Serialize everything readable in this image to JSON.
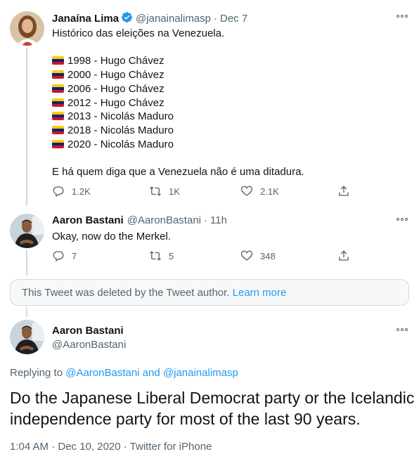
{
  "tweet1": {
    "name": "Janaína Lima",
    "handle": "@janainalimasp",
    "sep": "·",
    "time": "Dec 7",
    "intro": "Histórico das eleições na Venezuela.",
    "elections": [
      "1998 - Hugo Chávez",
      "2000 - Hugo Chávez",
      "2006 - Hugo Chávez",
      "2012 - Hugo Chávez",
      "2013 - Nicolás Maduro",
      "2018 - Nicolás Maduro",
      "2020 - Nicolás Maduro"
    ],
    "closing": "E há quem diga que a Venezuela não é uma ditadura.",
    "replies": "1.2K",
    "retweets": "1K",
    "likes": "2.1K"
  },
  "tweet2": {
    "name": "Aaron Bastani",
    "handle": "@AaronBastani",
    "sep": "·",
    "time": "11h",
    "text": "Okay, now do the Merkel.",
    "replies": "7",
    "retweets": "5",
    "likes": "348"
  },
  "deleted": {
    "text": "This Tweet was deleted by the Tweet author.",
    "link": "Learn more"
  },
  "main_tweet": {
    "name": "Aaron Bastani",
    "handle": "@AaronBastani",
    "replying_prefix": "Replying to",
    "replying_user1": "@AaronBastani",
    "replying_and": "and",
    "replying_user2": "@janainalimasp",
    "text": "Do the Japanese Liberal Democrat party or the Icelandic independence party for most of the last 90 years.",
    "meta": "1:04 AM · Dec 10, 2020 · Twitter for iPhone"
  },
  "colors": {
    "accent": "#1d9bf0",
    "secondary_text": "#536471",
    "flag_yellow": "#ffcc00",
    "flag_blue": "#00247d",
    "flag_red": "#cf142b"
  },
  "icons": [
    "verified-badge-icon",
    "more-icon",
    "reply-icon",
    "retweet-icon",
    "like-icon",
    "share-icon"
  ]
}
